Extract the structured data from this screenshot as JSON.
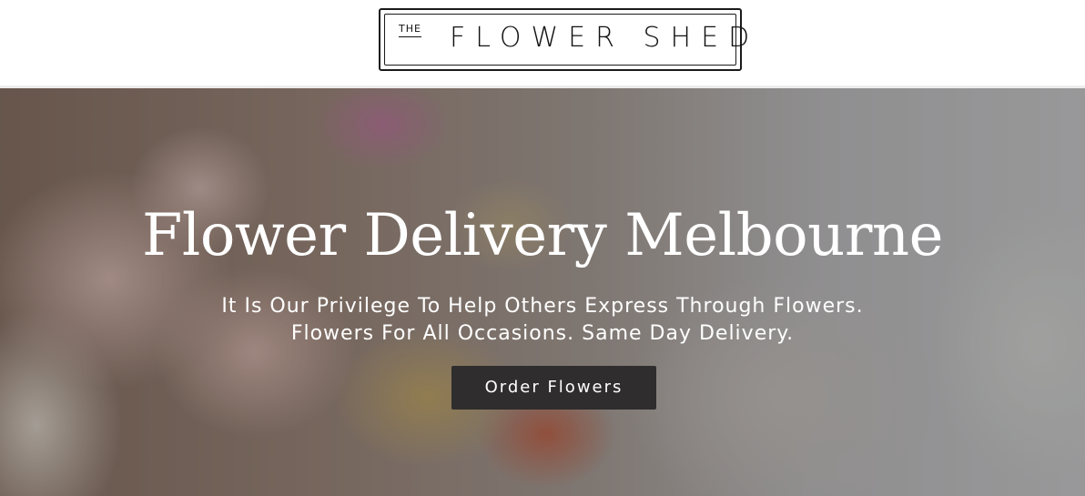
{
  "header": {
    "logo": {
      "the": "THE",
      "name": "FLOWER SHED"
    }
  },
  "hero": {
    "title": "Flower Delivery Melbourne",
    "subtitle_line1": "It Is Our Privilege To Help Others Express Through Flowers.",
    "subtitle_line2": "Flowers For All Occasions. Same Day Delivery.",
    "cta_label": "Order Flowers"
  },
  "colors": {
    "header_bg": "#ffffff",
    "logo_ink": "#111111",
    "button_bg": "#2f2d2d",
    "hero_text": "#ffffff"
  }
}
